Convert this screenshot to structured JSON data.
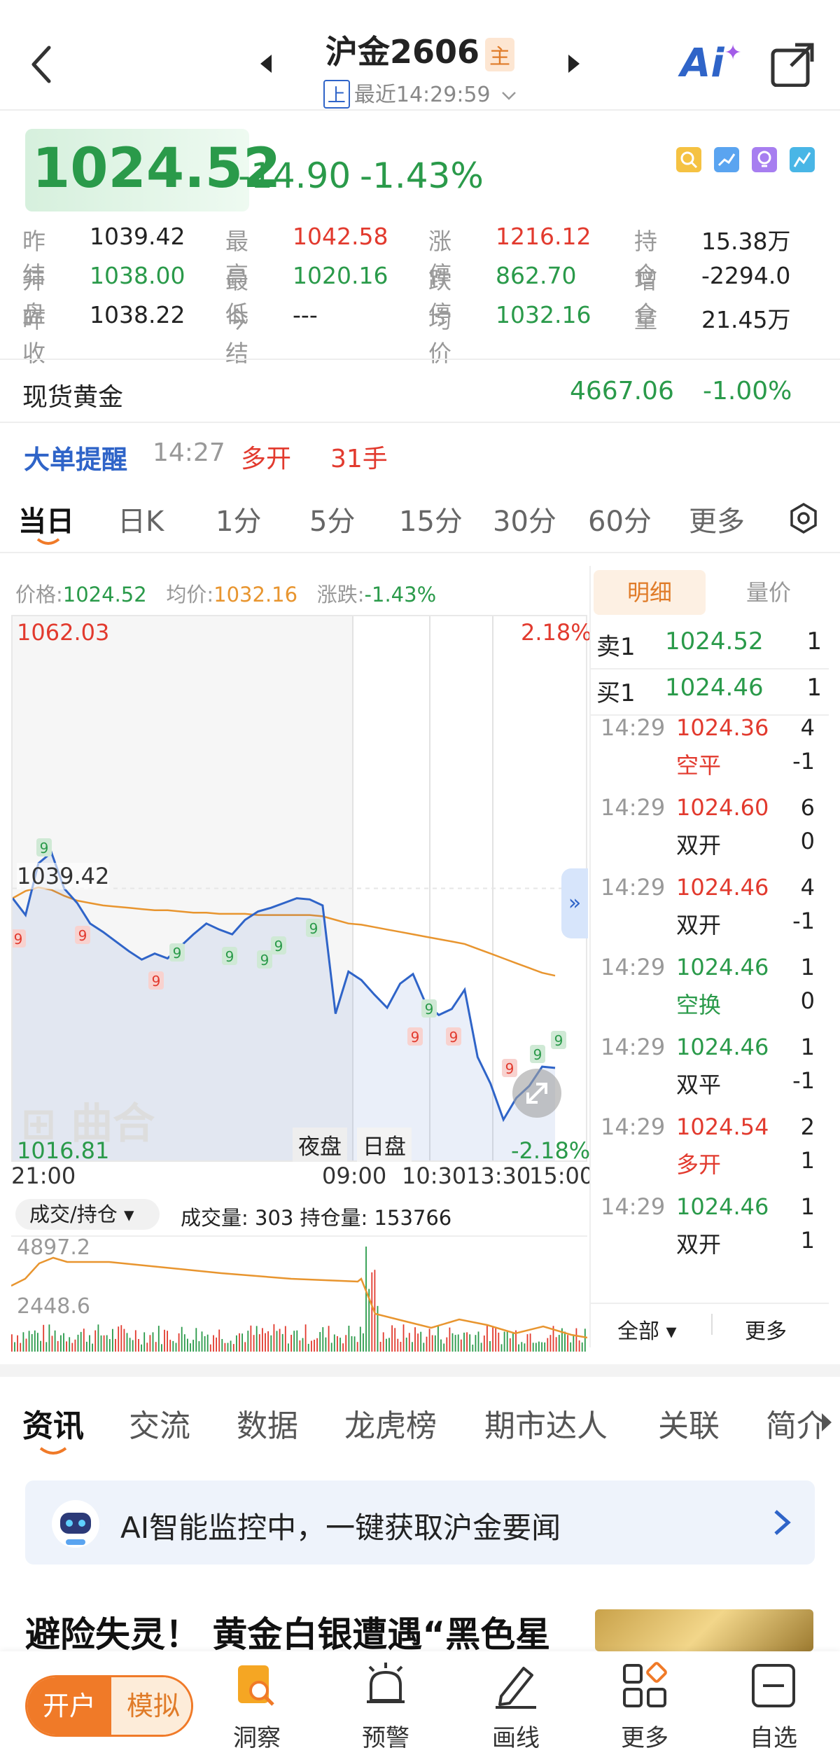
{
  "header": {
    "title": "沪金2606",
    "badge": "主",
    "market_tag": "上",
    "time_text": "最近14:29:59",
    "ai_label": "Ai"
  },
  "quote": {
    "price": "1024.52",
    "change": "-14.90",
    "change_pct": "-1.43%"
  },
  "stats": [
    {
      "label": "昨结",
      "value": "1039.42",
      "color": "dark"
    },
    {
      "label": "最高",
      "value": "1042.58",
      "color": "red"
    },
    {
      "label": "涨停",
      "value": "1216.12",
      "color": "red"
    },
    {
      "label": "持仓",
      "value": "15.38万",
      "color": "dark"
    },
    {
      "label": "开盘",
      "value": "1038.00",
      "color": "green"
    },
    {
      "label": "最低",
      "value": "1020.16",
      "color": "green"
    },
    {
      "label": "跌停",
      "value": "862.70",
      "color": "green"
    },
    {
      "label": "增仓",
      "value": "-2294.0",
      "color": "dark"
    },
    {
      "label": "昨收",
      "value": "1038.22",
      "color": "dark"
    },
    {
      "label": "今结",
      "value": "---",
      "color": "dark"
    },
    {
      "label": "均价",
      "value": "1032.16",
      "color": "green"
    },
    {
      "label": "量",
      "value": "21.45万",
      "color": "dark"
    }
  ],
  "spot": {
    "label": "现货黄金",
    "price": "4667.06",
    "pct": "-1.00%"
  },
  "alert": {
    "title": "大单提醒",
    "time": "14:27",
    "action": "多开",
    "qty": "31手"
  },
  "period_tabs": [
    "当日",
    "日K",
    "1分",
    "5分",
    "15分",
    "30分",
    "60分",
    "更多"
  ],
  "chart": {
    "info_price_label": "价格:",
    "info_price": "1024.52",
    "info_avg_label": "均价:",
    "info_avg": "1032.16",
    "info_chg_label": "涨跌:",
    "info_chg": "-1.43%",
    "top_left": "1062.03",
    "top_right": "2.18%",
    "mid_label": "1039.42",
    "bottom_left": "1016.81",
    "bottom_right": "-2.18%",
    "session_night": "夜盘",
    "session_day": "日盘",
    "times": [
      "21:00",
      "09:00",
      "10:30",
      "13:30",
      "15:00"
    ],
    "vol_selector": "成交/持仓",
    "vol_info": "成交量: 303 持仓量: 153766",
    "vol_top": "4897.2",
    "vol_mid": "2448.6",
    "watermark": "曲合",
    "marker": "9"
  },
  "chart_data": {
    "type": "line",
    "title": "",
    "series": [
      {
        "name": "价格",
        "values": [
          1038.6,
          1037.2,
          1041.5,
          1042.4,
          1039.4,
          1038.2,
          1036.5,
          1035.8,
          1035.0,
          1034.2,
          1033.5,
          1034.0,
          1033.6,
          1034.6,
          1035.6,
          1036.5,
          1036.0,
          1035.6,
          1036.8,
          1037.5,
          1037.8,
          1038.2,
          1038.6,
          1038.5,
          1038.0,
          1029.0,
          1032.5,
          1031.8,
          1030.6,
          1029.5,
          1031.5,
          1032.3,
          1029.8,
          1028.9,
          1029.4,
          1031.0,
          1025.4,
          1023.2,
          1020.2,
          1022.0,
          1023.0,
          1024.6,
          1024.5
        ],
        "color": "#2f64c8"
      },
      {
        "name": "均价",
        "values": [
          1038.6,
          1039.2,
          1039.5,
          1039.3,
          1038.8,
          1038.4,
          1038.2,
          1038.0,
          1037.9,
          1037.8,
          1037.7,
          1037.6,
          1037.6,
          1037.5,
          1037.4,
          1037.4,
          1037.3,
          1037.3,
          1037.3,
          1037.2,
          1037.2,
          1037.2,
          1037.2,
          1037.2,
          1037.1,
          1036.8,
          1036.5,
          1036.4,
          1036.2,
          1036.0,
          1035.8,
          1035.6,
          1035.4,
          1035.2,
          1035.0,
          1034.8,
          1034.4,
          1034.0,
          1033.6,
          1033.2,
          1032.8,
          1032.4,
          1032.16
        ],
        "color": "#e8952f"
      }
    ],
    "ylim": [
      1016.81,
      1062.03
    ],
    "x_ticks": [
      "21:00",
      "09:00",
      "10:30",
      "13:30",
      "15:00"
    ]
  },
  "detail_tabs": [
    "明细",
    "量价"
  ],
  "order_book": [
    {
      "side": "卖1",
      "price": "1024.52",
      "qty": "1"
    },
    {
      "side": "买1",
      "price": "1024.46",
      "qty": "1"
    }
  ],
  "ticks": [
    {
      "time": "14:29",
      "price": "1024.36",
      "qty": "4",
      "kind": "空平",
      "delta": "-1",
      "pcolor": "red",
      "kcolor": "red"
    },
    {
      "time": "14:29",
      "price": "1024.60",
      "qty": "6",
      "kind": "双开",
      "delta": "0",
      "pcolor": "red",
      "kcolor": "dark"
    },
    {
      "time": "14:29",
      "price": "1024.46",
      "qty": "4",
      "kind": "双开",
      "delta": "-1",
      "pcolor": "red",
      "kcolor": "dark"
    },
    {
      "time": "14:29",
      "price": "1024.46",
      "qty": "1",
      "kind": "空换",
      "delta": "0",
      "pcolor": "green",
      "kcolor": "green"
    },
    {
      "time": "14:29",
      "price": "1024.46",
      "qty": "1",
      "kind": "双平",
      "delta": "-1",
      "pcolor": "green",
      "kcolor": "dark"
    },
    {
      "time": "14:29",
      "price": "1024.54",
      "qty": "2",
      "kind": "多开",
      "delta": "1",
      "pcolor": "red",
      "kcolor": "red"
    },
    {
      "time": "14:29",
      "price": "1024.46",
      "qty": "1",
      "kind": "双开",
      "delta": "1",
      "pcolor": "green",
      "kcolor": "dark"
    }
  ],
  "tick_footer": {
    "all": "全部",
    "more": "更多"
  },
  "news_tabs": [
    "资讯",
    "交流",
    "数据",
    "龙虎榜",
    "期市达人",
    "关联",
    "简介"
  ],
  "ai_banner": "AI智能监控中，一键获取沪金要闻",
  "news_title": "避险失灵！ 黄金白银遭遇“黑色星",
  "bottom": {
    "open": "开户",
    "demo": "模拟",
    "items": [
      "洞察",
      "预警",
      "画线",
      "更多",
      "自选"
    ]
  }
}
